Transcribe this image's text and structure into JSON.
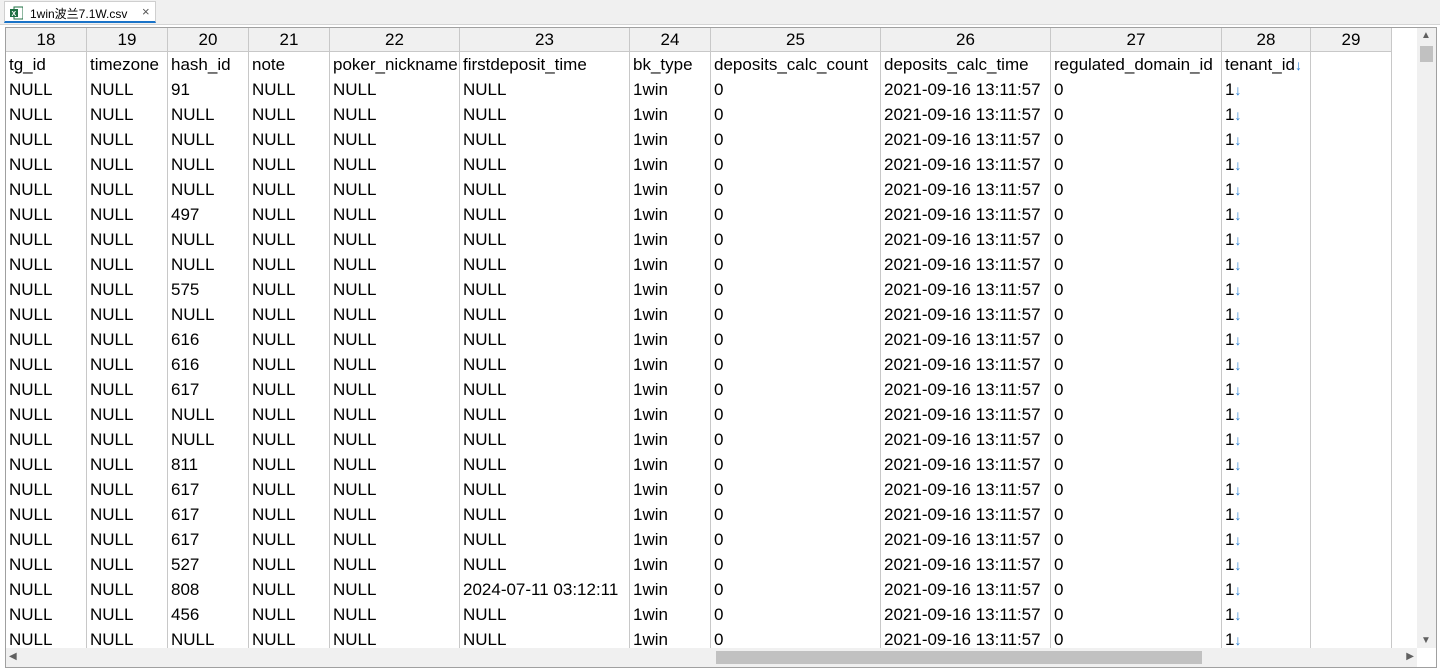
{
  "tab": {
    "title": "1win波兰7.1W.csv",
    "close": "×"
  },
  "columns": [
    "18",
    "19",
    "20",
    "21",
    "22",
    "23",
    "24",
    "25",
    "26",
    "27",
    "28",
    "29"
  ],
  "headers": [
    "tg_id",
    "timezone",
    "hash_id",
    "note",
    "poker_nickname",
    "firstdeposit_time",
    "bk_type",
    "deposits_calc_count",
    "deposits_calc_time",
    "regulated_domain_id",
    "tenant_id",
    ""
  ],
  "line_end_marker": "↓",
  "rows": [
    [
      "NULL",
      "NULL",
      "91",
      "NULL",
      "NULL",
      "NULL",
      "1win",
      "0",
      "2021-09-16 13:11:57",
      "0",
      "1",
      ""
    ],
    [
      "NULL",
      "NULL",
      "NULL",
      "NULL",
      "NULL",
      "NULL",
      "1win",
      "0",
      "2021-09-16 13:11:57",
      "0",
      "1",
      ""
    ],
    [
      "NULL",
      "NULL",
      "NULL",
      "NULL",
      "NULL",
      "NULL",
      "1win",
      "0",
      "2021-09-16 13:11:57",
      "0",
      "1",
      ""
    ],
    [
      "NULL",
      "NULL",
      "NULL",
      "NULL",
      "NULL",
      "NULL",
      "1win",
      "0",
      "2021-09-16 13:11:57",
      "0",
      "1",
      ""
    ],
    [
      "NULL",
      "NULL",
      "NULL",
      "NULL",
      "NULL",
      "NULL",
      "1win",
      "0",
      "2021-09-16 13:11:57",
      "0",
      "1",
      ""
    ],
    [
      "NULL",
      "NULL",
      "497",
      "NULL",
      "NULL",
      "NULL",
      "1win",
      "0",
      "2021-09-16 13:11:57",
      "0",
      "1",
      ""
    ],
    [
      "NULL",
      "NULL",
      "NULL",
      "NULL",
      "NULL",
      "NULL",
      "1win",
      "0",
      "2021-09-16 13:11:57",
      "0",
      "1",
      ""
    ],
    [
      "NULL",
      "NULL",
      "NULL",
      "NULL",
      "NULL",
      "NULL",
      "1win",
      "0",
      "2021-09-16 13:11:57",
      "0",
      "1",
      ""
    ],
    [
      "NULL",
      "NULL",
      "575",
      "NULL",
      "NULL",
      "NULL",
      "1win",
      "0",
      "2021-09-16 13:11:57",
      "0",
      "1",
      ""
    ],
    [
      "NULL",
      "NULL",
      "NULL",
      "NULL",
      "NULL",
      "NULL",
      "1win",
      "0",
      "2021-09-16 13:11:57",
      "0",
      "1",
      ""
    ],
    [
      "NULL",
      "NULL",
      "616",
      "NULL",
      "NULL",
      "NULL",
      "1win",
      "0",
      "2021-09-16 13:11:57",
      "0",
      "1",
      ""
    ],
    [
      "NULL",
      "NULL",
      "616",
      "NULL",
      "NULL",
      "NULL",
      "1win",
      "0",
      "2021-09-16 13:11:57",
      "0",
      "1",
      ""
    ],
    [
      "NULL",
      "NULL",
      "617",
      "NULL",
      "NULL",
      "NULL",
      "1win",
      "0",
      "2021-09-16 13:11:57",
      "0",
      "1",
      ""
    ],
    [
      "NULL",
      "NULL",
      "NULL",
      "NULL",
      "NULL",
      "NULL",
      "1win",
      "0",
      "2021-09-16 13:11:57",
      "0",
      "1",
      ""
    ],
    [
      "NULL",
      "NULL",
      "NULL",
      "NULL",
      "NULL",
      "NULL",
      "1win",
      "0",
      "2021-09-16 13:11:57",
      "0",
      "1",
      ""
    ],
    [
      "NULL",
      "NULL",
      "811",
      "NULL",
      "NULL",
      "NULL",
      "1win",
      "0",
      "2021-09-16 13:11:57",
      "0",
      "1",
      ""
    ],
    [
      "NULL",
      "NULL",
      "617",
      "NULL",
      "NULL",
      "NULL",
      "1win",
      "0",
      "2021-09-16 13:11:57",
      "0",
      "1",
      ""
    ],
    [
      "NULL",
      "NULL",
      "617",
      "NULL",
      "NULL",
      "NULL",
      "1win",
      "0",
      "2021-09-16 13:11:57",
      "0",
      "1",
      ""
    ],
    [
      "NULL",
      "NULL",
      "617",
      "NULL",
      "NULL",
      "NULL",
      "1win",
      "0",
      "2021-09-16 13:11:57",
      "0",
      "1",
      ""
    ],
    [
      "NULL",
      "NULL",
      "527",
      "NULL",
      "NULL",
      "NULL",
      "1win",
      "0",
      "2021-09-16 13:11:57",
      "0",
      "1",
      ""
    ],
    [
      "NULL",
      "NULL",
      "808",
      "NULL",
      "NULL",
      "2024-07-11 03:12:11",
      "1win",
      "0",
      "2021-09-16 13:11:57",
      "0",
      "1",
      ""
    ],
    [
      "NULL",
      "NULL",
      "456",
      "NULL",
      "NULL",
      "NULL",
      "1win",
      "0",
      "2021-09-16 13:11:57",
      "0",
      "1",
      ""
    ],
    [
      "NULL",
      "NULL",
      "NULL",
      "NULL",
      "NULL",
      "NULL",
      "1win",
      "0",
      "2021-09-16 13:11:57",
      "0",
      "1",
      ""
    ]
  ],
  "scrollbars": {
    "up": "▲",
    "down": "▼",
    "left": "◀",
    "right": "▶"
  },
  "colors": {
    "tab_accent": "#1a73c8",
    "line_end_marker": "#2a7fd4",
    "excel_icon": "#1d6f42"
  }
}
